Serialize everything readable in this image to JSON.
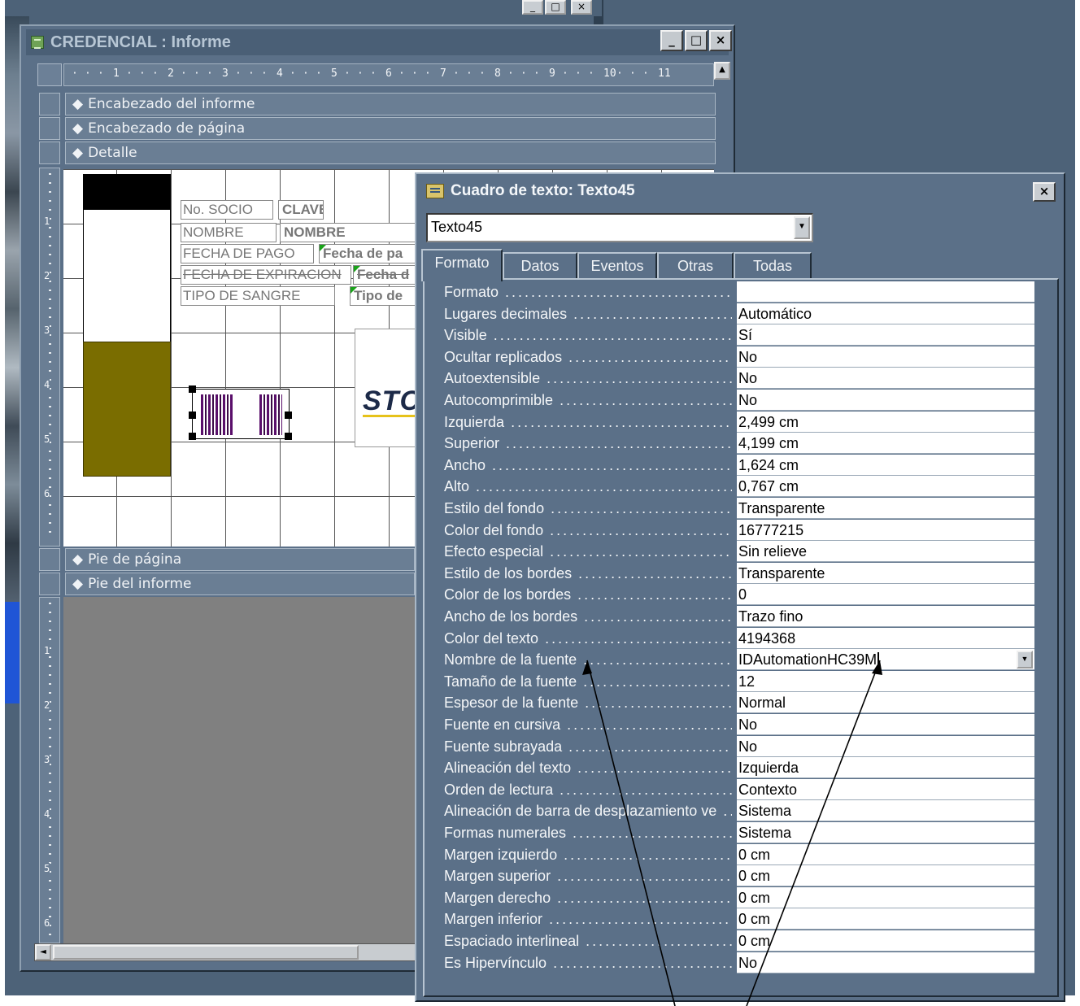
{
  "back_window": {
    "min": "_",
    "max": "□",
    "close": "×"
  },
  "report": {
    "title": "CREDENCIAL : Informe",
    "buttons": {
      "min": "_",
      "max": "□",
      "close": "×"
    },
    "ruler_ticks": [
      "1",
      "2",
      "3",
      "4",
      "5",
      "6",
      "7",
      "8",
      "9",
      "10",
      "11"
    ],
    "sections": {
      "report_header": "Encabezado del informe",
      "page_header": "Encabezado de página",
      "detail": "Detalle",
      "page_footer": "Pie de página",
      "report_footer": "Pie del informe"
    },
    "detail_vruler": [
      "1",
      "2",
      "3",
      "4",
      "5",
      "6"
    ],
    "footer_vruler": [
      "1",
      "2",
      "3",
      "4",
      "5",
      "6"
    ],
    "labels": {
      "socio": "No. SOCIO",
      "nombre": "NOMBRE",
      "fecha_pago": "FECHA DE PAGO",
      "fecha_exp": "FECHA DE EXPIRACION",
      "tipo_sangre": "TIPO DE SANGRE"
    },
    "fields": {
      "clave": "CLAVE",
      "nombre": "NOMBRE",
      "fecha_pago": "Fecha de pa",
      "fecha_exp": "Fecha d",
      "tipo": "Tipo de"
    },
    "logo_text": "STC"
  },
  "props": {
    "title": "Cuadro de texto: Texto45",
    "close": "×",
    "selected_object": "Texto45",
    "tabs": [
      "Formato",
      "Datos",
      "Eventos",
      "Otras",
      "Todas"
    ],
    "active_tab": "Formato",
    "rows": [
      {
        "label": "Formato",
        "value": ""
      },
      {
        "label": "Lugares decimales",
        "value": "Automático"
      },
      {
        "label": "Visible",
        "value": "Sí"
      },
      {
        "label": "Ocultar replicados",
        "value": "No"
      },
      {
        "label": "Autoextensible",
        "value": "No"
      },
      {
        "label": "Autocomprimible",
        "value": "No"
      },
      {
        "label": "Izquierda",
        "value": "2,499 cm"
      },
      {
        "label": "Superior",
        "value": "4,199 cm"
      },
      {
        "label": "Ancho",
        "value": "1,624 cm"
      },
      {
        "label": "Alto",
        "value": "0,767 cm"
      },
      {
        "label": "Estilo del fondo",
        "value": "Transparente"
      },
      {
        "label": "Color del fondo",
        "value": "16777215"
      },
      {
        "label": "Efecto especial",
        "value": "Sin relieve"
      },
      {
        "label": "Estilo de los bordes",
        "value": "Transparente"
      },
      {
        "label": "Color de los bordes",
        "value": "0"
      },
      {
        "label": "Ancho de los bordes",
        "value": "Trazo fino"
      },
      {
        "label": "Color del texto",
        "value": "4194368"
      },
      {
        "label": "Nombre de la fuente",
        "value": "IDAutomationHC39M"
      },
      {
        "label": "Tamaño de la fuente",
        "value": "12"
      },
      {
        "label": "Espesor de la fuente",
        "value": "Normal"
      },
      {
        "label": "Fuente en cursiva",
        "value": "No"
      },
      {
        "label": "Fuente subrayada",
        "value": "No"
      },
      {
        "label": "Alineación del texto",
        "value": "Izquierda"
      },
      {
        "label": "Orden de lectura",
        "value": "Contexto"
      },
      {
        "label": "Alineación de barra de desplazamiento ve",
        "value": "Sistema"
      },
      {
        "label": "Formas numerales",
        "value": "Sistema"
      },
      {
        "label": "Margen izquierdo",
        "value": "0 cm"
      },
      {
        "label": "Margen superior",
        "value": "0 cm"
      },
      {
        "label": "Margen derecho",
        "value": "0 cm"
      },
      {
        "label": "Margen inferior",
        "value": "0 cm"
      },
      {
        "label": "Espaciado interlineal",
        "value": "0 cm"
      },
      {
        "label": "Es Hipervínculo",
        "value": "No"
      }
    ]
  },
  "colors": {
    "desktop": "#4d6278",
    "window_face": "#5b7088",
    "olive": "#7a6d00",
    "barcode": "#5a0f6b"
  }
}
